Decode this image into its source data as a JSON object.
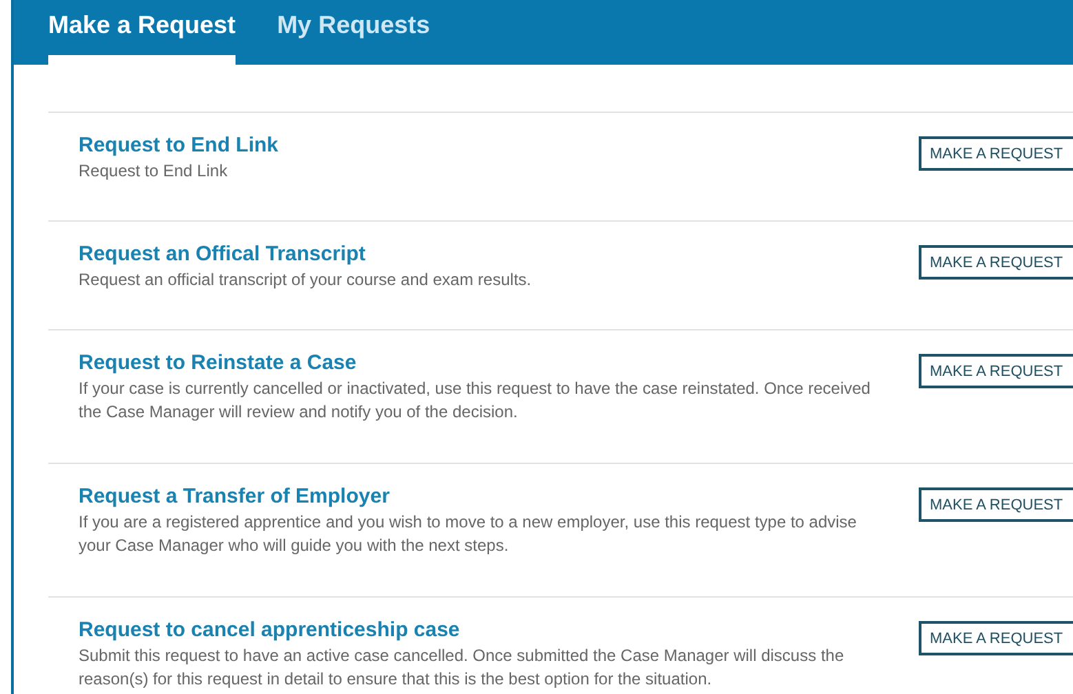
{
  "tabs": [
    {
      "label": "Make a Request",
      "selected": true
    },
    {
      "label": "My Requests",
      "selected": false
    }
  ],
  "requests": [
    {
      "title": "Request to End Link",
      "description": "Request to End Link",
      "button": "MAKE A REQUEST"
    },
    {
      "title": "Request an Offical Transcript",
      "description": "Request an official transcript of your course and exam results.",
      "button": "MAKE A REQUEST"
    },
    {
      "title": "Request to Reinstate a Case",
      "description": "If your case is currently cancelled or inactivated, use this request to have the case reinstated. Once received the Case Manager will review and notify you of the decision.",
      "button": "MAKE A REQUEST"
    },
    {
      "title": "Request a Transfer of Employer",
      "description": "If you are a registered apprentice and you wish to move to a new employer, use this request type to advise your Case Manager who will guide you with the next steps.",
      "button": "MAKE A REQUEST"
    },
    {
      "title": "Request to cancel apprenticeship case",
      "description": "Submit this request to have an active case cancelled. Once submitted the Case Manager will discuss the reason(s) for this request in detail to ensure that this is the best option for the situation.",
      "button": "MAKE A REQUEST"
    }
  ]
}
